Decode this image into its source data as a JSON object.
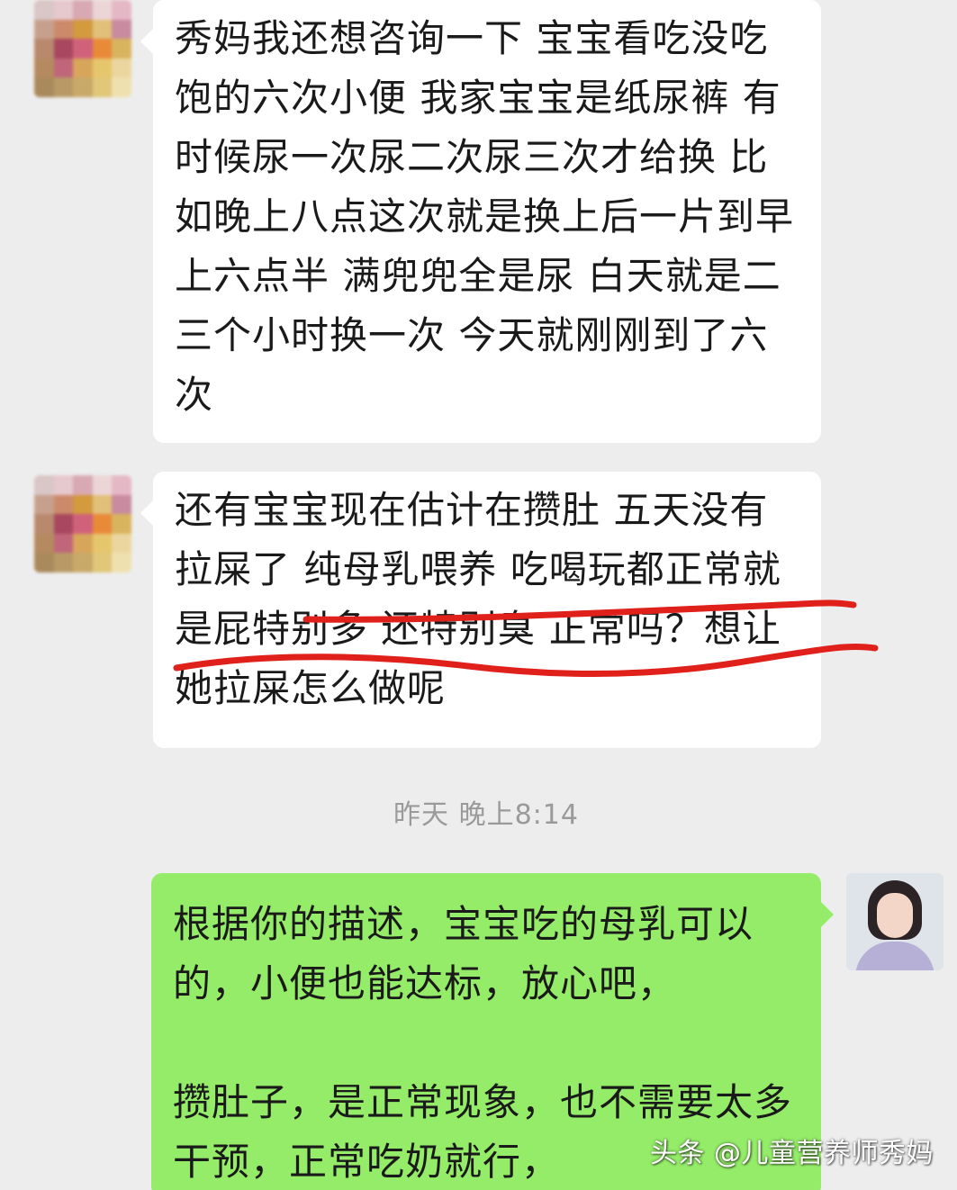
{
  "messages": [
    {
      "side": "left",
      "text": "秀妈我还想咨询一下 宝宝看吃没吃饱的六次小便 我家宝宝是纸尿裤 有时候尿一次尿二次尿三次才给换 比如晚上八点这次就是换上后一片到早上六点半 满兜兜全是尿 白天就是二三个小时换一次 今天就刚刚到了六次"
    },
    {
      "side": "left",
      "text": "还有宝宝现在估计在攒肚 五天没有拉屎了 纯母乳喂养 吃喝玩都正常就是屁特别多 还特别臭 正常吗？想让她拉屎怎么做呢"
    },
    {
      "side": "right",
      "text": "根据你的描述，宝宝吃的母乳可以的，小便也能达标，放心吧，\n\n攒肚子，是正常现象，也不需要太多干预，正常吃奶就行，"
    }
  ],
  "timestamp": "昨天 晚上8:14",
  "watermark": "头条 @儿童营养师秀妈",
  "colors": {
    "background": "#ededed",
    "received_bubble": "#ffffff",
    "sent_bubble": "#95ec69",
    "underline": "#e0201b",
    "timestamp": "#9a9a9a"
  }
}
